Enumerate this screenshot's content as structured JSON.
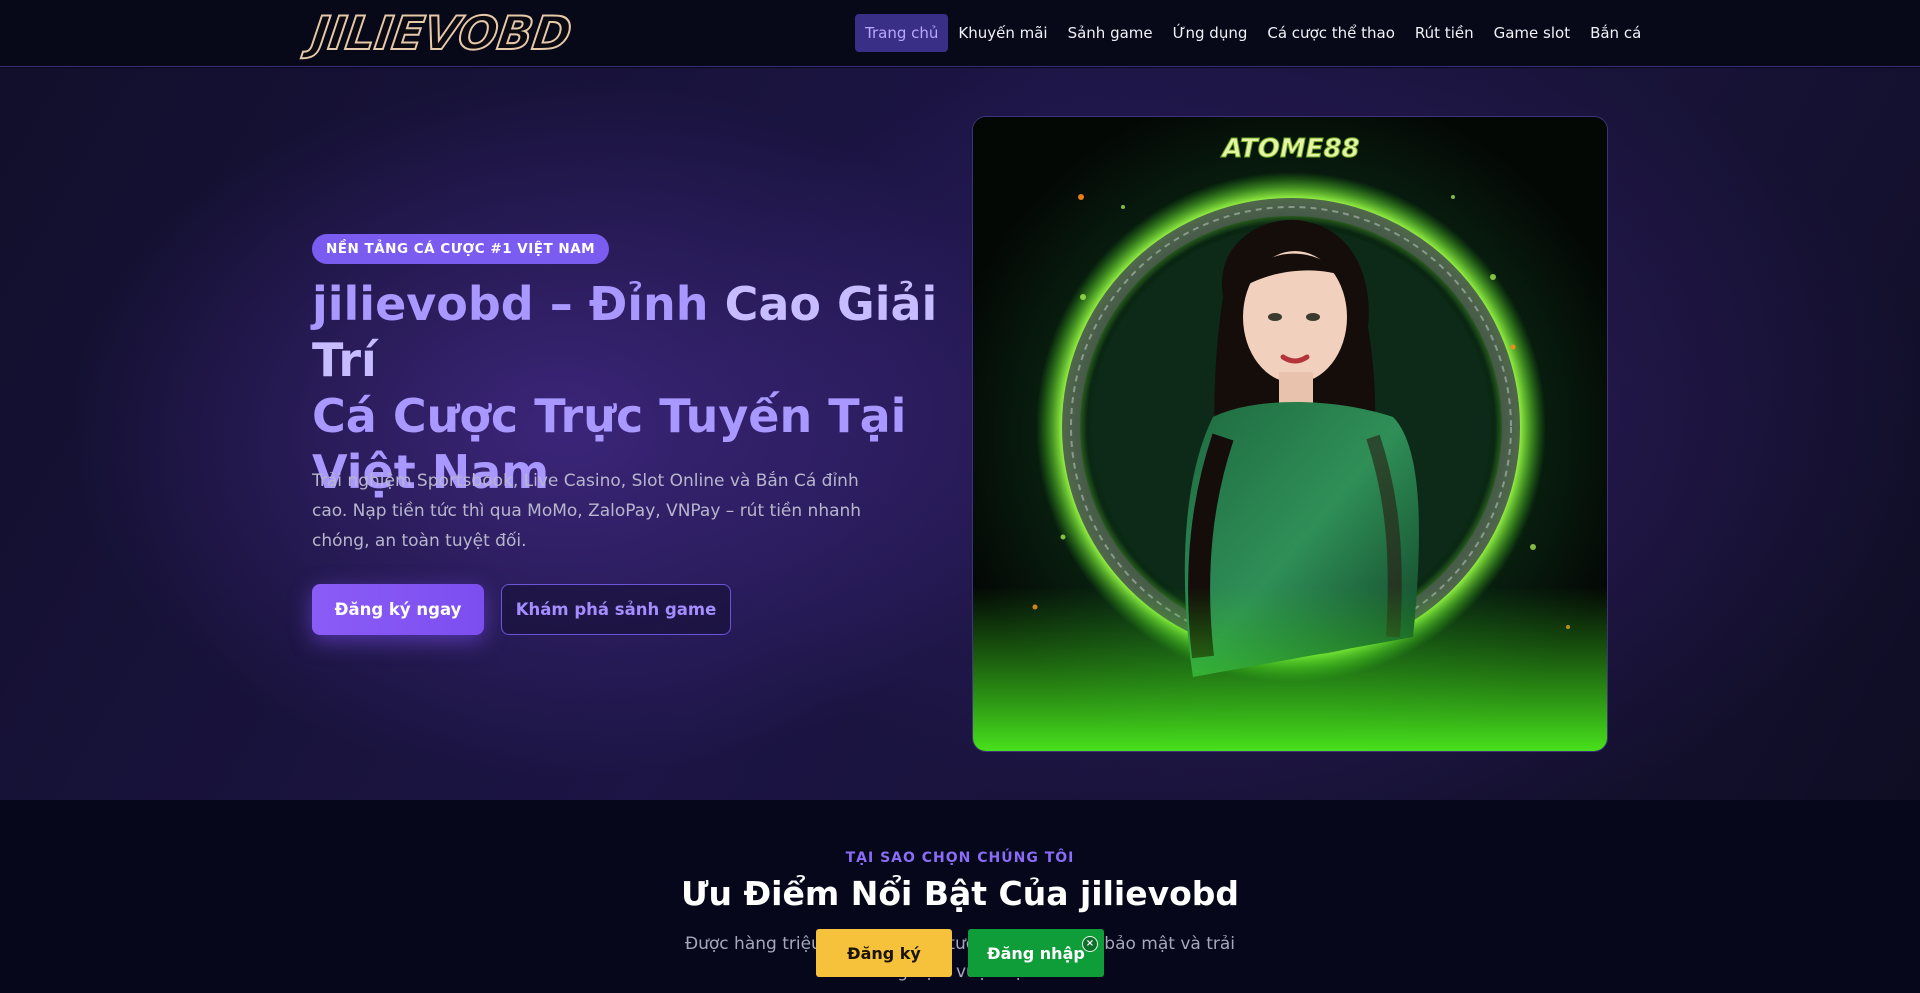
{
  "header": {
    "logo_text": "JILIEVOBD",
    "nav": [
      {
        "label": "Trang chủ",
        "active": true
      },
      {
        "label": "Khuyến mãi"
      },
      {
        "label": "Sảnh game"
      },
      {
        "label": "Ứng dụng"
      },
      {
        "label": "Cá cược thể thao"
      },
      {
        "label": "Rút tiền"
      },
      {
        "label": "Game slot"
      },
      {
        "label": "Bắn cá"
      }
    ]
  },
  "hero": {
    "badge": "NỀN TẢNG CÁ CƯỢC #1 VIỆT NAM",
    "title_line1a": "jilievobd – Đỉnh ",
    "title_line1b": "Cao Giải Trí",
    "title_line2": "Cá Cược Trực Tuyến Tại",
    "title_line3": "Việt Nam",
    "description": "Trải nghiệm Sportsbook, Live Casino, Slot Online và Bắn Cá đỉnh cao. Nạp tiền tức thì qua MoMo, ZaloPay, VNPay – rút tiền nhanh chóng, an toàn tuyệt đối.",
    "primary_button": "Đăng ký ngay",
    "secondary_button": "Khám phá sảnh game",
    "image_brand_text": "ATOME88"
  },
  "features": {
    "eyebrow": "TẠI SAO CHỌN CHÚNG TÔI",
    "title": "Ưu Điểm Nổi Bật Của jilievobd",
    "description": "Được hàng triệu người chơi tin tưởng nhờ tốc độ, bảo mật và trải nghiệm vượt trội."
  },
  "sticky_bar": {
    "register": "Đăng ký",
    "login": "Đăng nhập",
    "close_glyph": "×"
  },
  "colors": {
    "accent": "#8b5cf6",
    "register": "#f6c23b",
    "login": "#0f9d3a"
  }
}
